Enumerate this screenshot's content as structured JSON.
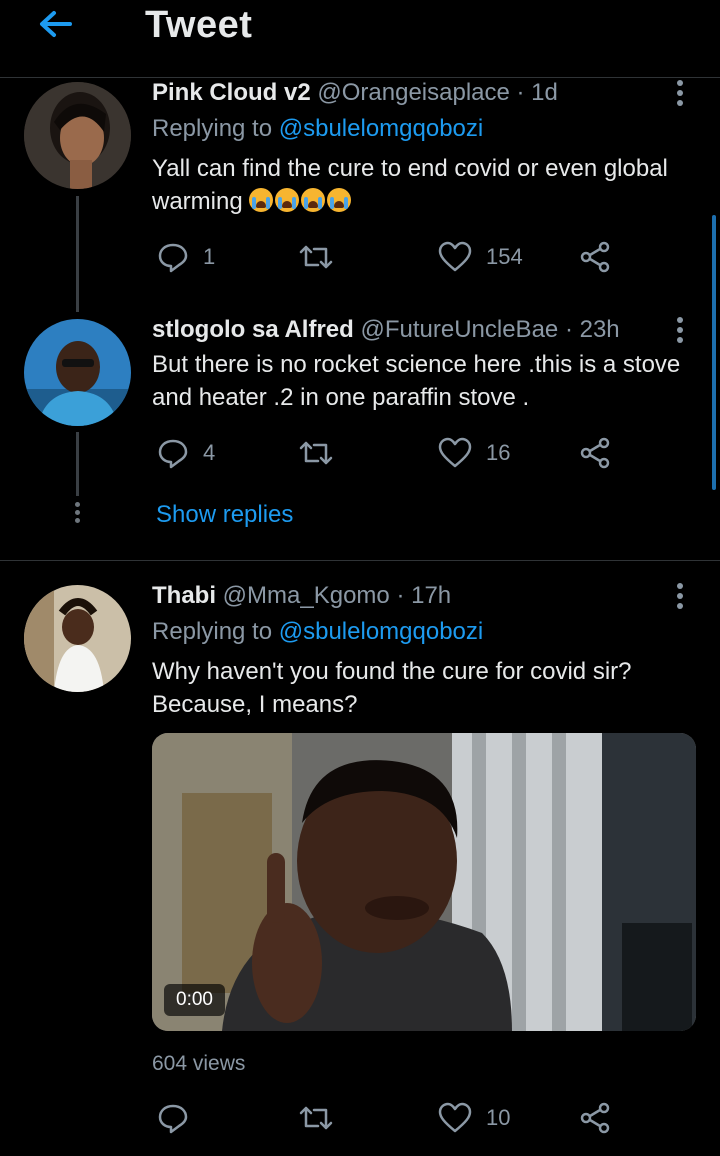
{
  "header": {
    "title": "Tweet",
    "back_icon": "arrow-left-icon"
  },
  "colors": {
    "accent": "#1d9bf0",
    "background": "#000000",
    "muted": "#8b98a5"
  },
  "tweets": [
    {
      "name": "Pink Cloud v2",
      "handle": "@Orangeisaplace",
      "time": "· 1d",
      "replying_prefix": "Replying to",
      "replying_to": "@sbulelomgqobozi",
      "text": "Yall can find the cure to end covid or even global warming",
      "emoji": "loudly-crying-face ×4",
      "replies": "1",
      "retweets": "",
      "likes": "154"
    },
    {
      "name": "stlogolo sa Alfred",
      "handle": "@FutureUncleBae",
      "time": "· 23h",
      "text": "But there is no rocket science here .this is a stove and heater .2 in one paraffin stove .",
      "replies": "4",
      "retweets": "",
      "likes": "16",
      "show_replies": "Show replies"
    },
    {
      "name": "Thabi",
      "handle": "@Mma_Kgomo",
      "time": "· 17h",
      "replying_prefix": "Replying to",
      "replying_to": "@sbulelomgqobozi",
      "text_line1": "Why haven't you found the cure for covid sir?",
      "text_line2": "Because, I means?",
      "video_duration": "0:00",
      "views": "604 views",
      "replies": "",
      "retweets": "",
      "likes": "10"
    }
  ]
}
